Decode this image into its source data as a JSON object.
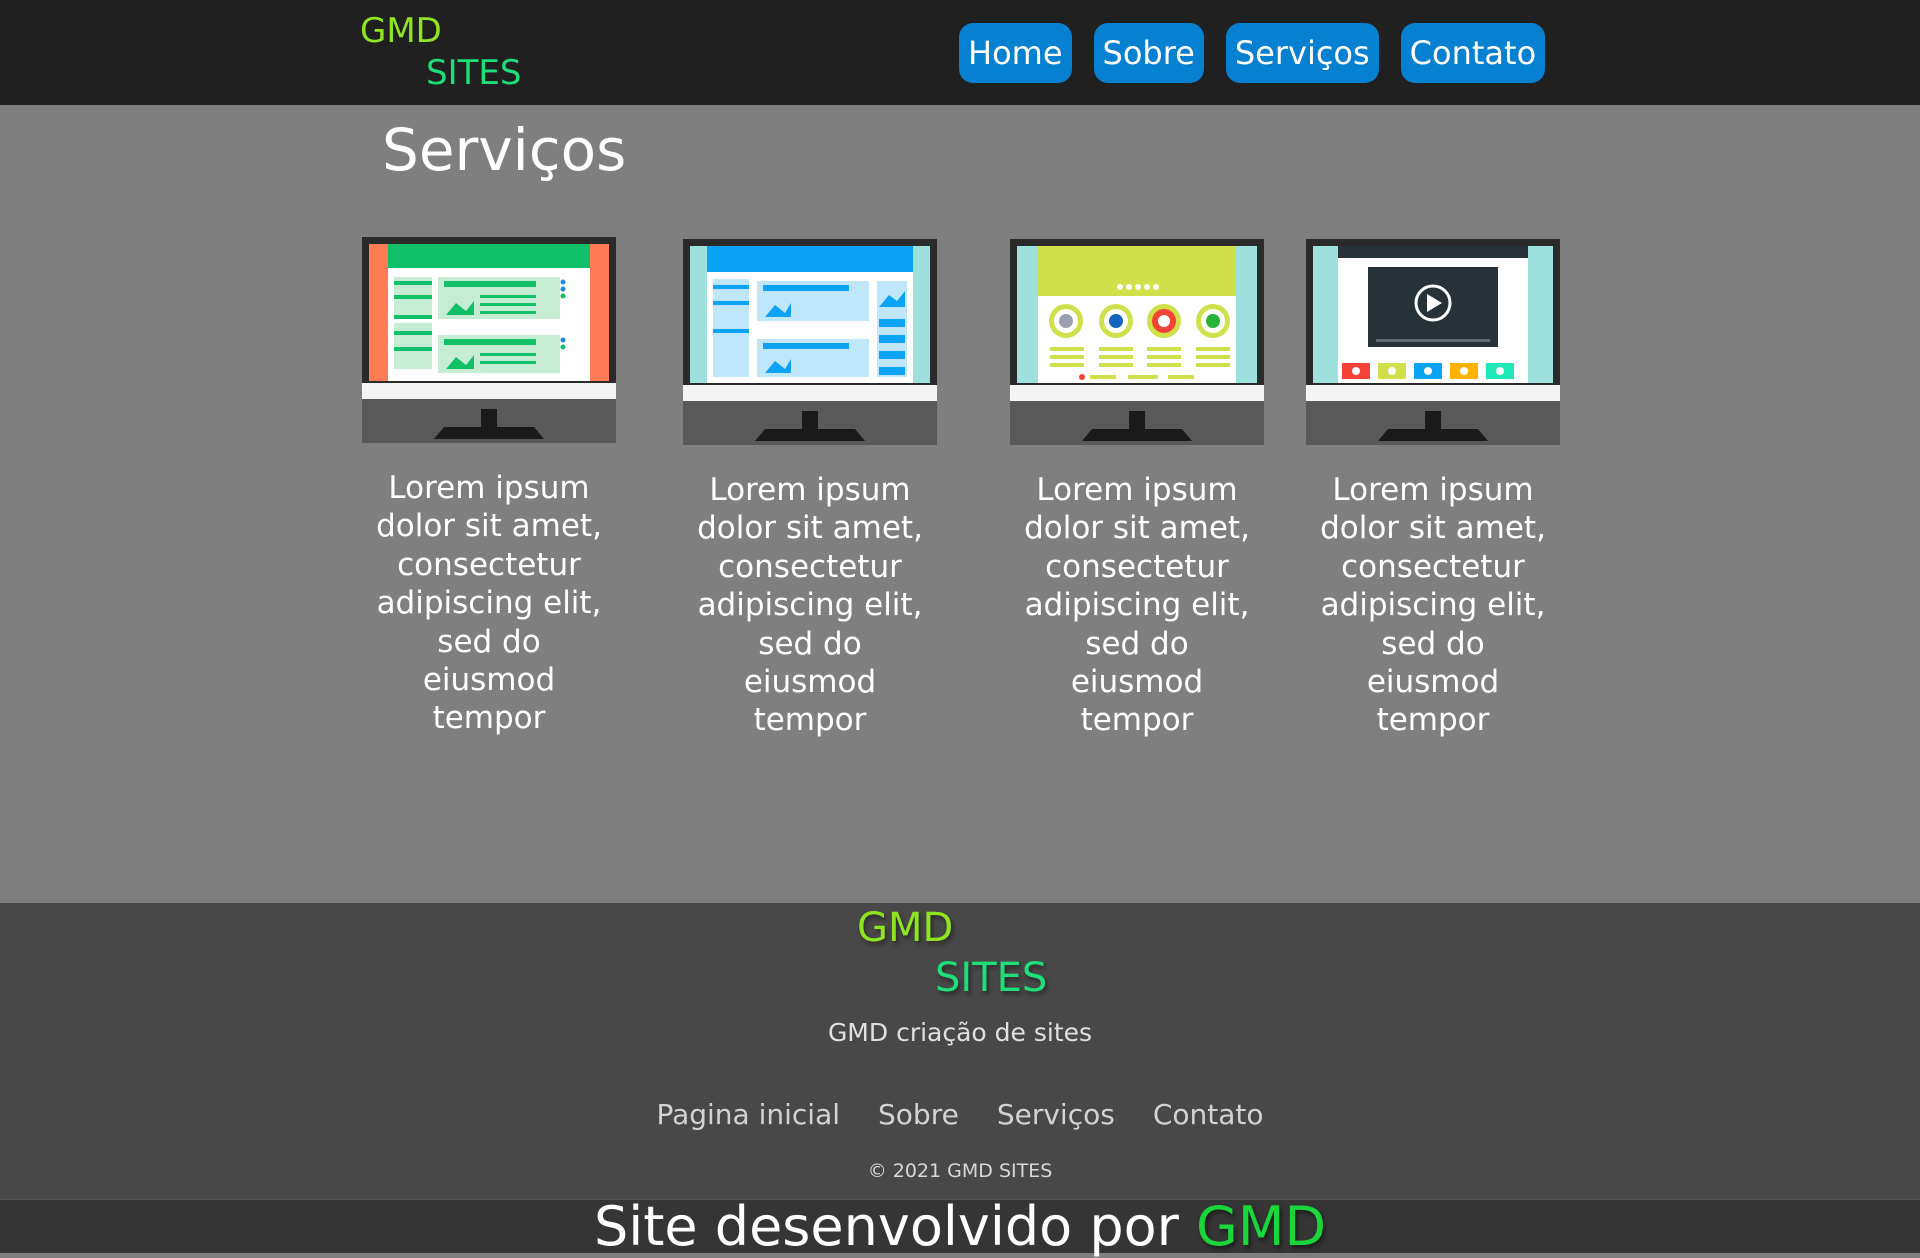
{
  "header": {
    "logo_line1": "GMD",
    "logo_line2": "SITES",
    "nav": [
      "Home",
      "Sobre",
      "Serviços",
      "Contato"
    ]
  },
  "main": {
    "title": "Serviços",
    "cards": [
      {
        "illustration": "website-layout-monitor-icon",
        "text": "Lorem ipsum dolor sit amet, consectetur adipiscing elit, sed do eiusmod tempor"
      },
      {
        "illustration": "blog-layout-monitor-icon",
        "text": "Lorem ipsum dolor sit amet, consectetur adipiscing elit, sed do eiusmod tempor"
      },
      {
        "illustration": "badges-page-monitor-icon",
        "text": "Lorem ipsum dolor sit amet, consectetur adipiscing elit, sed do eiusmod tempor"
      },
      {
        "illustration": "video-player-monitor-icon",
        "text": "Lorem ipsum dolor sit amet, consectetur adipiscing elit, sed do eiusmod tempor"
      }
    ]
  },
  "footer": {
    "logo_line1": "GMD",
    "logo_line2": "SITES",
    "tagline": "GMD criação de sites",
    "links": [
      "Pagina inicial",
      "Sobre",
      "Serviços",
      "Contato"
    ],
    "copyright": "© 2021 GMD SITES"
  },
  "credit": {
    "text": "Site desenvolvido por",
    "brand": "GMD"
  },
  "colors": {
    "header_bg": "#202020",
    "main_bg": "#7f7f7f",
    "footer_bg": "#484848",
    "nav_button": "#0680d1",
    "logo_green_1": "#8fe51f",
    "logo_green_2": "#1ede7a"
  }
}
